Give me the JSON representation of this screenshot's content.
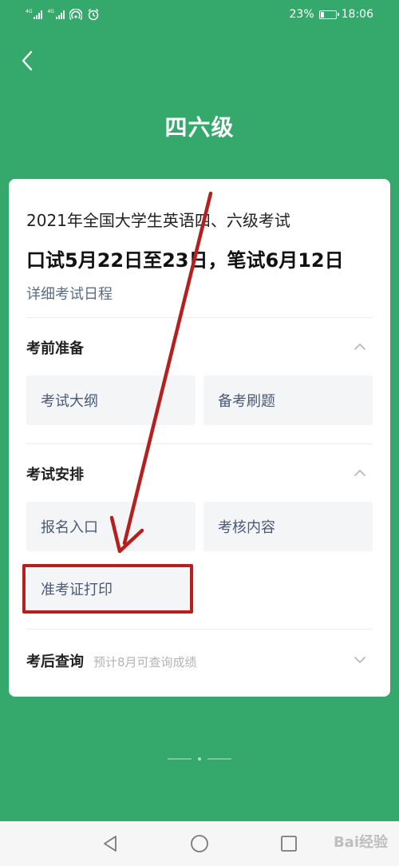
{
  "status_bar": {
    "network_1": "4G",
    "network_2": "4G",
    "battery_percent": "23%",
    "battery_level": 0.23,
    "time": "18:06"
  },
  "header": {
    "back_icon": "chevron-left-icon",
    "title": "四六级"
  },
  "exam": {
    "name": "2021年全国大学生英语四、六级考试",
    "dates": "口试5月22日至23日，笔试6月12日",
    "schedule_link": "详细考试日程"
  },
  "sections": [
    {
      "title": "考前准备",
      "expanded": true,
      "items": [
        {
          "label": "考试大纲"
        },
        {
          "label": "备考刷题"
        }
      ]
    },
    {
      "title": "考试安排",
      "expanded": true,
      "items": [
        {
          "label": "报名入口"
        },
        {
          "label": "考核内容"
        },
        {
          "label": "准考证打印"
        }
      ]
    },
    {
      "title": "考后查询",
      "note": "预计8月可查询成绩",
      "expanded": false
    }
  ],
  "annotation": {
    "color": "#b5201f",
    "highlighted_item": "准考证打印"
  },
  "nav_bar": {
    "back": "triangle-back-icon",
    "home": "circle-home-icon",
    "recents": "square-recents-icon"
  },
  "watermark": "Bai经验",
  "colors": {
    "primary_green": "#35a86c",
    "tile_bg": "#f4f5f7",
    "tile_text": "#4a5a76"
  }
}
